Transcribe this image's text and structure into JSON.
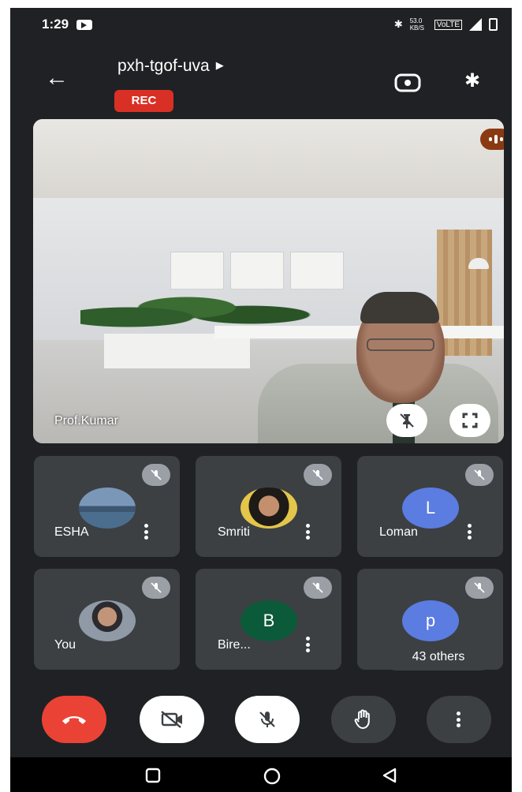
{
  "status_bar": {
    "time": "1:29",
    "right_text": "53.0 KB/S"
  },
  "header": {
    "meeting_code": "pxh-tgof-uva",
    "rec_badge": "REC"
  },
  "main_video": {
    "name": "Prof.Kumar"
  },
  "participants": [
    {
      "name": "ESHA",
      "avatar_type": "photo",
      "muted": true
    },
    {
      "name": "Smriti",
      "avatar_type": "photo",
      "muted": true
    },
    {
      "name": "Loman",
      "avatar_type": "letter",
      "avatar_letter": "L",
      "avatar_color": "#5b7ce0",
      "muted": true
    },
    {
      "name": "You",
      "avatar_type": "photo",
      "muted": true
    },
    {
      "name": "Bire...",
      "avatar_type": "letter",
      "avatar_letter": "B",
      "avatar_color": "#0b5a3a",
      "muted": true
    },
    {
      "name": "",
      "avatar_type": "letter",
      "avatar_letter": "p",
      "avatar_color": "#5b7ce0",
      "muted": true
    }
  ],
  "others_label": "43 others",
  "controls": {
    "end_call_color": "#ea4335",
    "icons": [
      "end-call-icon",
      "camera-off-icon",
      "mic-off-icon",
      "raise-hand-icon",
      "more-options-icon"
    ]
  },
  "colors": {
    "background": "#202124",
    "tile": "#3c4043",
    "rec": "#d93025",
    "speaking": "#8a3a12"
  }
}
